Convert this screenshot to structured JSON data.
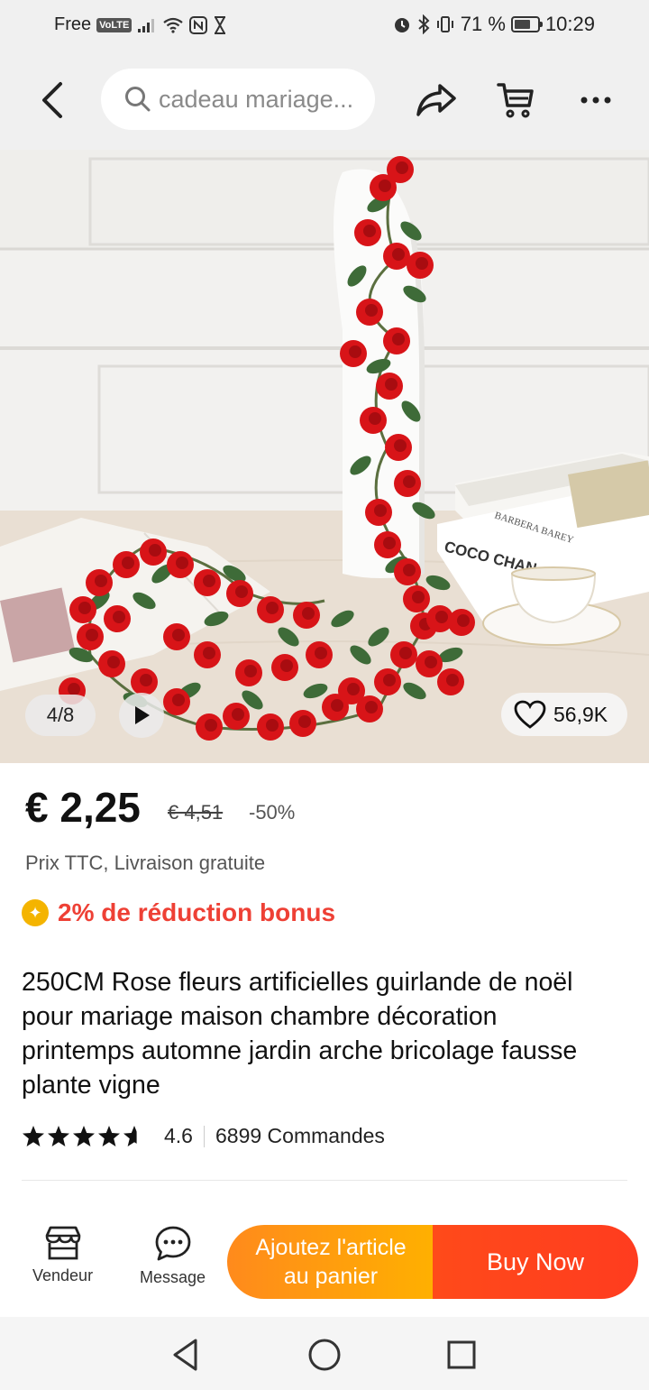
{
  "status_bar": {
    "carrier": "Free",
    "volte": "VoLTE",
    "battery_percent": "71 %",
    "battery_level": 0.71,
    "time": "10:29"
  },
  "top_bar": {
    "search_placeholder": "cadeau mariage..."
  },
  "gallery": {
    "counter": "4/8",
    "likes": "56,9K",
    "book_text_1": "BARBERA BAREY",
    "book_text_2": "COCO CHAN"
  },
  "product": {
    "price": "€ 2,25",
    "old_price": "€ 4,51",
    "discount": "-50%",
    "tax_info": "Prix TTC, Livraison gratuite",
    "bonus": "2% de réduction bonus",
    "title": "250CM Rose fleurs artificielles guirlande de noël pour mariage maison chambre décoration printemps automne jardin arche bricolage fausse plante vigne",
    "rating": "4.6",
    "rating_value": 4.6,
    "orders": "6899 Commandes"
  },
  "bottom_bar": {
    "seller_label": "Vendeur",
    "message_label": "Message",
    "add_to_cart": "Ajoutez l'article au panier",
    "buy_now": "Buy Now"
  },
  "colors": {
    "accent_orange": "#ff9a10",
    "accent_red": "#ff4a1a",
    "bonus_red": "#ee4035",
    "bonus_yellow": "#f4b400"
  },
  "icons": [
    "back-icon",
    "search-icon",
    "share-icon",
    "cart-icon",
    "more-icon",
    "play-icon",
    "heart-icon",
    "star-icon",
    "store-icon",
    "chat-icon",
    "nav-back-icon",
    "nav-home-icon",
    "nav-recents-icon"
  ]
}
